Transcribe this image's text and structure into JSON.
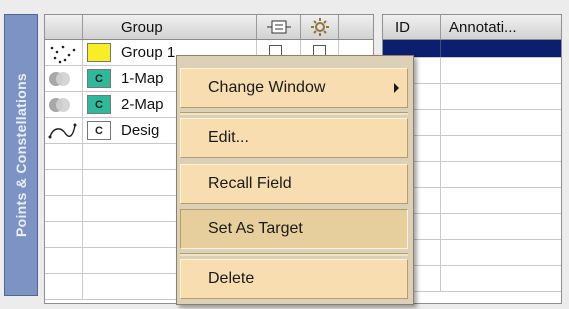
{
  "side_tab": {
    "label": "Points & Constellations"
  },
  "left_table": {
    "headers": {
      "group": "Group",
      "col_visibility_icon": "layer-toggle-icon",
      "col_settings_icon": "gear-icon"
    },
    "rows": [
      {
        "name": "Group 1",
        "swatch_color": "#f7ee25",
        "swatch_letter": "",
        "icon": "scatter-points-icon"
      },
      {
        "name": "1-Map",
        "swatch_color": "#2fb89a",
        "swatch_letter": "C",
        "icon": "circles-icon"
      },
      {
        "name": "2-Map",
        "swatch_color": "#2fb89a",
        "swatch_letter": "C",
        "icon": "circles-icon"
      },
      {
        "name": "Desig",
        "swatch_color": "#ffffff",
        "swatch_letter": "C",
        "icon": "curve-path-icon"
      }
    ]
  },
  "right_table": {
    "headers": {
      "id": "ID",
      "annotation": "Annotati..."
    },
    "selected_row_color": "#0b1f6e"
  },
  "context_menu": {
    "items": [
      {
        "label": "Change Window",
        "has_submenu": true
      },
      {
        "label": "Edit..."
      },
      {
        "label": "Recall Field"
      },
      {
        "label": "Set As Target",
        "selected": true
      },
      {
        "label": "Delete"
      }
    ]
  }
}
